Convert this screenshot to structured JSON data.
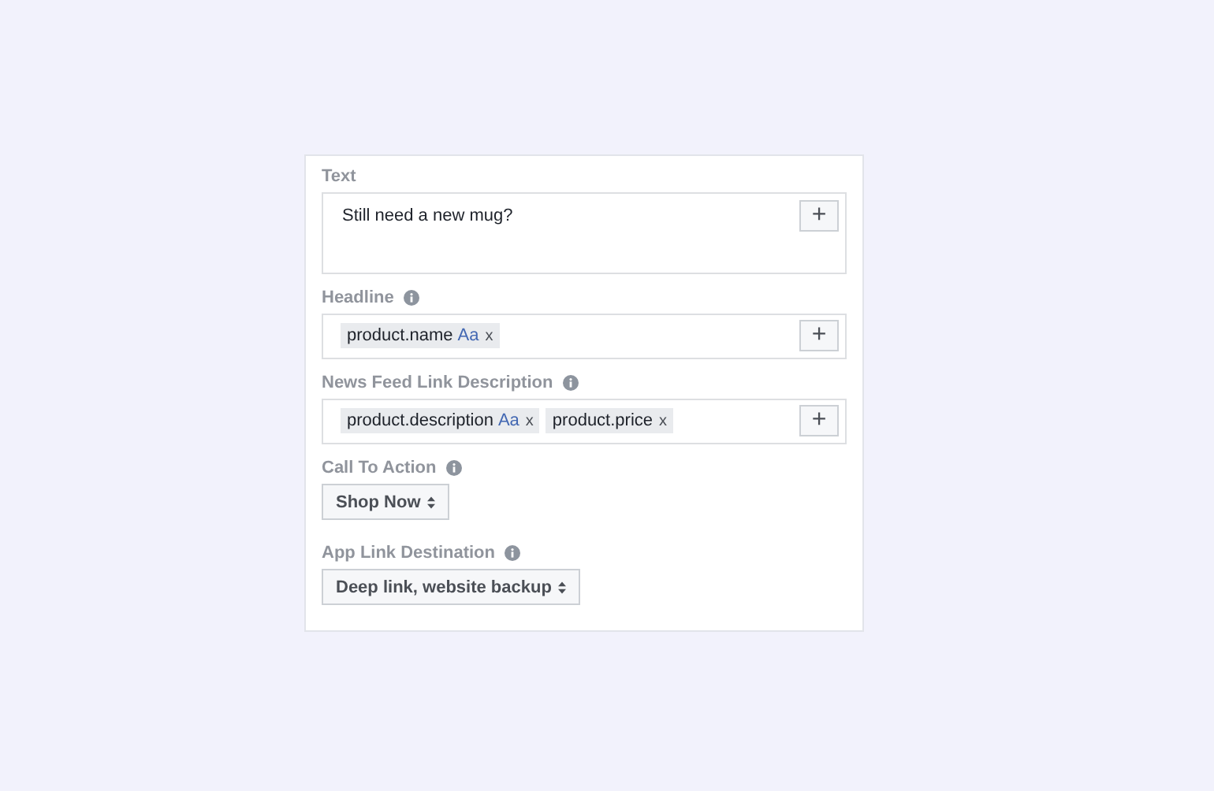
{
  "fields": [
    {
      "kind": "text",
      "label": "Text",
      "info": false,
      "value": "Still need a new mug?",
      "add_button": "+"
    },
    {
      "kind": "tags",
      "label": "Headline",
      "info": true,
      "tags": [
        {
          "text": "product.name",
          "format": "Aa",
          "remove": "x"
        }
      ],
      "add_button": "+"
    },
    {
      "kind": "tags",
      "label": "News Feed Link Description",
      "info": true,
      "tags": [
        {
          "text": "product.description",
          "format": "Aa",
          "remove": "x"
        },
        {
          "text": "product.price",
          "remove": "x"
        }
      ],
      "add_button": "+"
    },
    {
      "kind": "select",
      "label": "Call To Action",
      "info": true,
      "value": "Shop Now"
    },
    {
      "kind": "select",
      "label": "App Link Destination",
      "info": true,
      "value": "Deep link, website backup"
    }
  ]
}
